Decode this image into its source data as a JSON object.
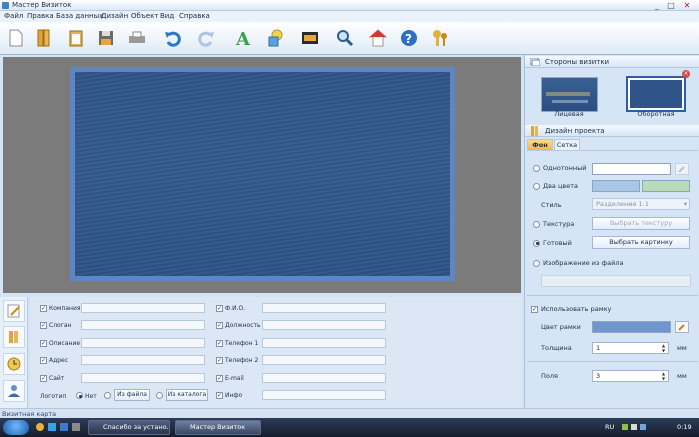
{
  "window": {
    "title": "Мастер Визиток",
    "controls": [
      "_",
      "□",
      "✕"
    ]
  },
  "menu": [
    "Файл",
    "Правка",
    "База данных",
    "Дизайн",
    "Объект",
    "Вид",
    "Справка"
  ],
  "toolbar": {
    "icons": [
      "new-document-icon",
      "open-folder-icon",
      "clipboard-icon",
      "save-icon",
      "print-icon",
      "undo-icon",
      "redo-icon",
      "text-tool-icon",
      "shapes-tool-icon",
      "image-tool-icon",
      "zoom-icon",
      "home-icon",
      "help-icon",
      "keys-icon"
    ]
  },
  "canvas": {
    "background_color": "#7b7b7b",
    "frame_color": "#5f86c4"
  },
  "fields": {
    "left": [
      {
        "label": "Компания",
        "checked": true
      },
      {
        "label": "Слоган",
        "checked": true
      },
      {
        "label": "Описание",
        "checked": true
      },
      {
        "label": "Адрес",
        "checked": true
      },
      {
        "label": "Сайт",
        "checked": true
      }
    ],
    "right": [
      {
        "label": "Ф.И.О.",
        "checked": true
      },
      {
        "label": "Должность",
        "checked": true
      },
      {
        "label": "Телефон 1",
        "checked": true
      },
      {
        "label": "Телефон 2",
        "checked": true
      },
      {
        "label": "E-mail",
        "checked": true
      },
      {
        "label": "Инфо",
        "checked": true
      }
    ],
    "logo": {
      "label": "Логотип",
      "opt_none": "Нет",
      "from_file": "Из файла",
      "from_catalog": "Из каталога"
    }
  },
  "right_panel": {
    "sides_title": "Стороны визитки",
    "front_label": "Лицевая",
    "back_label": "Оборотная",
    "design_title": "Дизайн проекта",
    "tabs": [
      "Фон",
      "Сетка"
    ],
    "opt_solid": "Однотонный",
    "opt_two_colors": "Два цвета",
    "style_label": "Стиль",
    "style_value": "Разделение 1:1",
    "opt_texture": "Текстура",
    "choose_texture": "Выбрать текстуру",
    "opt_ready": "Готовый",
    "choose_picture": "Выбрать картинку",
    "opt_from_file": "Изображение из файла",
    "use_frame": "Использовать рамку",
    "frame_color_label": "Цвет рамки",
    "thickness_label": "Толщина",
    "thickness_value": "1",
    "margins_label": "Поля",
    "margins_value": "3",
    "unit": "мм",
    "colors": {
      "solid": "#ffffff",
      "two_a": "#a8c6e8",
      "two_b": "#b9dcb8",
      "frame": "#6f96cf"
    }
  },
  "statusbar": {
    "text": "Визитная карта"
  },
  "taskbar": {
    "tasks": [
      "Спасибо за устано...",
      "Мастер Визиток"
    ],
    "lang": "RU",
    "clock": "0:19"
  }
}
